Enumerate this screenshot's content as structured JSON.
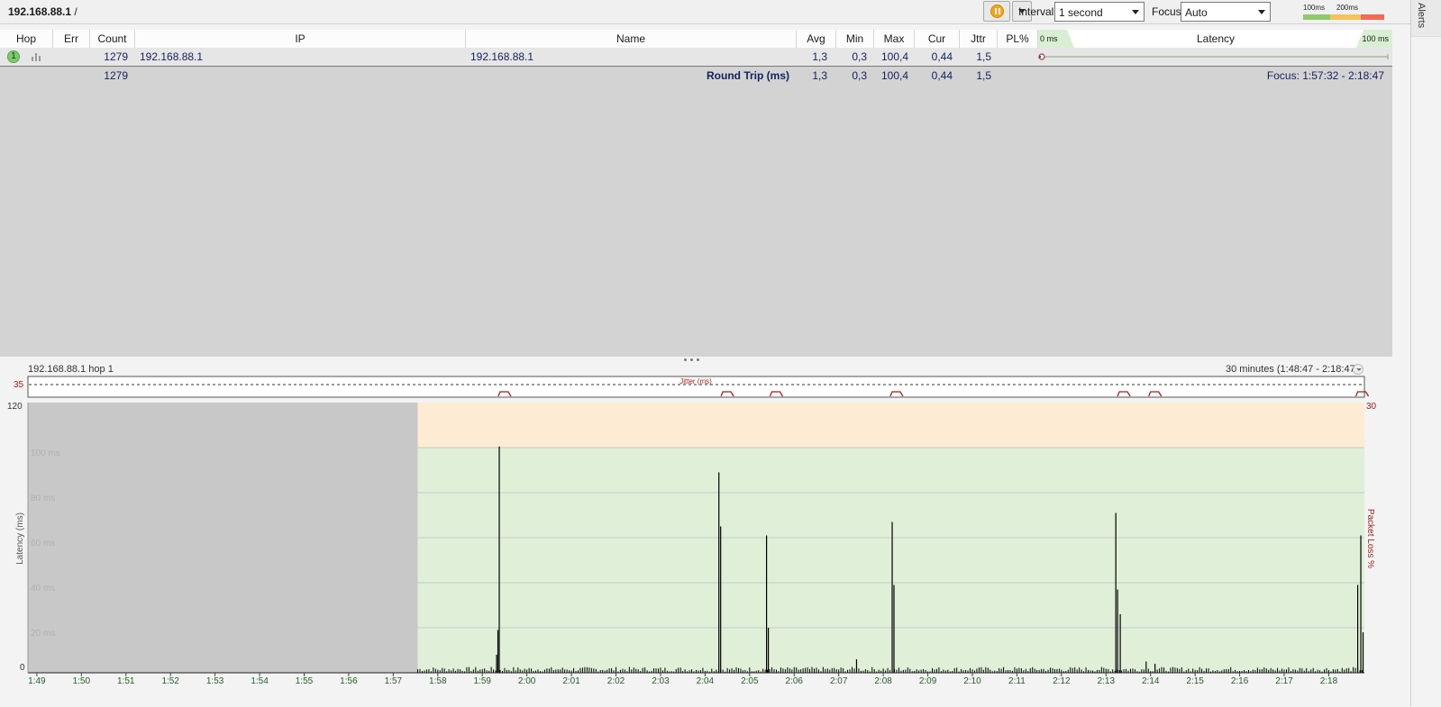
{
  "header": {
    "target": "192.168.88.1",
    "target_sep": " /",
    "interval_label": "Interval",
    "interval_value": "1 second",
    "focus_label": "Focus",
    "focus_value": "Auto",
    "scale_100": "100ms",
    "scale_200": "200ms",
    "scale_colors": [
      "#8fca6a",
      "#f6c35a",
      "#f26b53"
    ]
  },
  "alerts_label": "Alerts",
  "table": {
    "columns": [
      "Hop",
      "Err",
      "Count",
      "IP",
      "Name",
      "Avg",
      "Min",
      "Max",
      "Cur",
      "Jttr",
      "PL%"
    ],
    "latency_header": {
      "min": "0 ms",
      "title": "Latency",
      "max": "100 ms"
    },
    "rows": [
      {
        "hop": "1",
        "err": "",
        "count": "1279",
        "ip": "192.168.88.1",
        "name": "192.168.88.1",
        "avg": "1,3",
        "min": "0,3",
        "max": "100,4",
        "cur": "0,44",
        "jttr": "1,5",
        "pl": ""
      }
    ],
    "summary": {
      "count": "1279",
      "label": "Round Trip (ms)",
      "avg": "1,3",
      "min": "0,3",
      "max": "100,4",
      "cur": "0,44",
      "jttr": "1,5",
      "focus": "Focus: 1:57:32 - 2:18:47"
    }
  },
  "graph": {
    "title": "192.168.88.1 hop 1",
    "range": "30 minutes (1:48:47 - 2:18:47)",
    "jitter_label": "Jitter (ms)",
    "jitter_max": "35",
    "pl_max": "30"
  },
  "chart_data": {
    "type": "bar",
    "title": "",
    "ylabel": "Latency (ms)",
    "y2label": "Packet Loss %",
    "ylim": [
      0,
      120
    ],
    "y2lim": [
      0,
      30
    ],
    "ytick_top": "120",
    "ytick_bottom": "0",
    "ytick_labels": [
      "100 ms",
      "80 ms",
      "60 ms",
      "40 ms",
      "20 ms"
    ],
    "ytick_values": [
      100,
      80,
      60,
      40,
      20
    ],
    "x_ticks": [
      "1:49",
      "1:50",
      "1:51",
      "1:52",
      "1:53",
      "1:54",
      "1:55",
      "1:56",
      "1:57",
      "1:58",
      "1:59",
      "2:00",
      "2:01",
      "2:02",
      "2:03",
      "2:04",
      "2:05",
      "2:06",
      "2:07",
      "2:08",
      "2:09",
      "2:10",
      "2:11",
      "2:12",
      "2:13",
      "2:14",
      "2:15",
      "2:16",
      "2:17",
      "2:18"
    ],
    "no_data_until_minutes": 8.75,
    "warning_above_ms": 100,
    "spikes": [
      {
        "t": 10.58,
        "ms": 100.5
      },
      {
        "t": 10.55,
        "ms": 19
      },
      {
        "t": 10.52,
        "ms": 8
      },
      {
        "t": 15.51,
        "ms": 89
      },
      {
        "t": 15.55,
        "ms": 65
      },
      {
        "t": 16.58,
        "ms": 61
      },
      {
        "t": 16.62,
        "ms": 20
      },
      {
        "t": 19.4,
        "ms": 67
      },
      {
        "t": 19.44,
        "ms": 39
      },
      {
        "t": 18.6,
        "ms": 6
      },
      {
        "t": 24.42,
        "ms": 71
      },
      {
        "t": 24.46,
        "ms": 37
      },
      {
        "t": 24.52,
        "ms": 26
      },
      {
        "t": 25.1,
        "ms": 5
      },
      {
        "t": 25.3,
        "ms": 4
      },
      {
        "t": 29.85,
        "ms": 39
      },
      {
        "t": 29.92,
        "ms": 61
      },
      {
        "t": 29.97,
        "ms": 18
      }
    ],
    "baseline_ms": 1.3,
    "jitter_events_minutes": [
      10.7,
      15.7,
      16.8,
      19.5,
      24.6,
      25.3,
      29.95
    ]
  }
}
